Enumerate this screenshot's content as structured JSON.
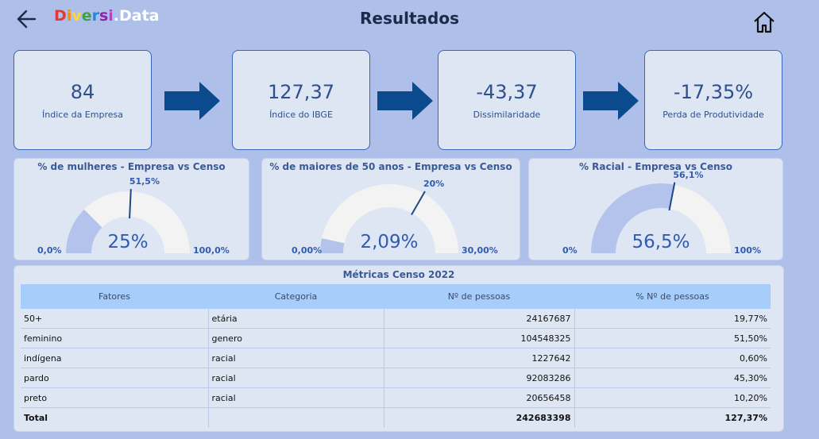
{
  "header": {
    "logo_parts": [
      {
        "t": "D",
        "c": "#e53935"
      },
      {
        "t": "i",
        "c": "#fb8c00"
      },
      {
        "t": "v",
        "c": "#fdd835"
      },
      {
        "t": "e",
        "c": "#43a047"
      },
      {
        "t": "r",
        "c": "#1e88e5"
      },
      {
        "t": "s",
        "c": "#8e24aa"
      },
      {
        "t": "i",
        "c": "#ab47bc"
      }
    ],
    "logo_dot": ".",
    "logo_rest": "Data",
    "title": "Resultados"
  },
  "kpis": [
    {
      "value": "84",
      "label": "Índice da Empresa"
    },
    {
      "value": "127,37",
      "label": "Índice do IBGE"
    },
    {
      "value": "-43,37",
      "label": "Dissimilaridade"
    },
    {
      "value": "-17,35%",
      "label": "Perda de Produtividade"
    }
  ],
  "gauges": [
    {
      "title": "% de mulheres - Empresa vs Censo",
      "min_label": "0,0%",
      "max_label": "100,0%",
      "target_label": "51,5%",
      "value_label": "25%",
      "min": 0,
      "max": 100,
      "value": 25,
      "target": 51.5
    },
    {
      "title": "% de maiores de 50 anos - Empresa vs Censo",
      "min_label": "0,00%",
      "max_label": "30,00%",
      "target_label": "20%",
      "value_label": "2,09%",
      "min": 0,
      "max": 30,
      "value": 2.09,
      "target": 20
    },
    {
      "title": "% Racial - Empresa vs Censo",
      "min_label": "0%",
      "max_label": "100%",
      "target_label": "56,1%",
      "value_label": "56,5%",
      "min": 0,
      "max": 100,
      "value": 56.5,
      "target": 56.1
    }
  ],
  "colors": {
    "gauge_fill": "#b3c3ec",
    "gauge_track": "#f3f3f3",
    "accent": "#2f5bb0",
    "arrow": "#0b4a8c"
  },
  "table": {
    "title": "Métricas Censo 2022",
    "headers": [
      "Fatores",
      "Categoria",
      "Nº de pessoas",
      "% Nº de pessoas"
    ],
    "rows": [
      [
        "50+",
        "etária",
        "24167687",
        "19,77%"
      ],
      [
        "feminino",
        "genero",
        "104548325",
        "51,50%"
      ],
      [
        "indígena",
        "racial",
        "1227642",
        "0,60%"
      ],
      [
        "pardo",
        "racial",
        "92083286",
        "45,30%"
      ],
      [
        "preto",
        "racial",
        "20656458",
        "10,20%"
      ]
    ],
    "total": [
      "Total",
      "",
      "242683398",
      "127,37%"
    ]
  }
}
